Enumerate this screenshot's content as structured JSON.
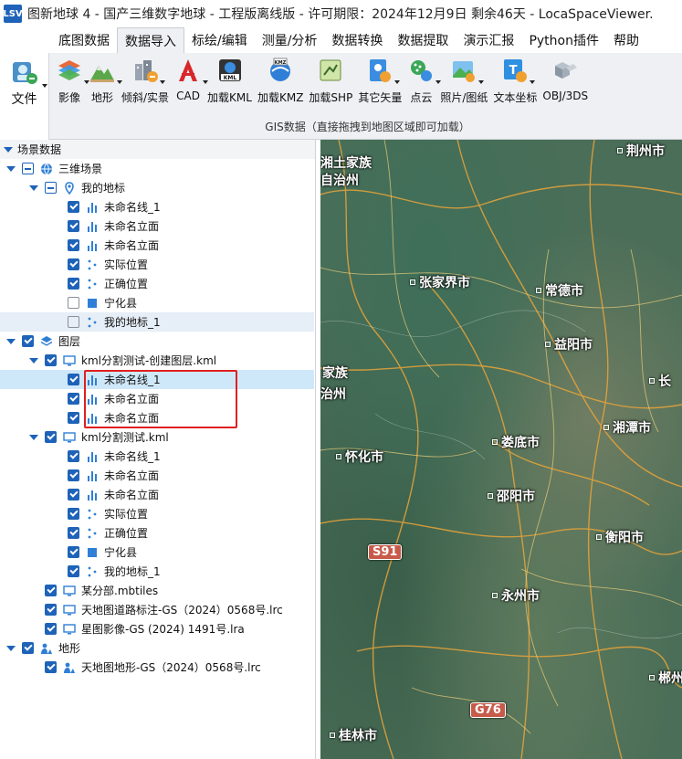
{
  "window": {
    "title": "图新地球 4 - 国产三维数字地球 - 工程版离线版 - 许可期限：2024年12月9日 剩余46天 - LocaSpaceViewer.",
    "logo_text": "LSV"
  },
  "menu": {
    "tabs": [
      {
        "label": "底图数据",
        "active": false
      },
      {
        "label": "数据导入",
        "active": true
      },
      {
        "label": "标绘/编辑",
        "active": false
      },
      {
        "label": "测量/分析",
        "active": false
      },
      {
        "label": "数据转换",
        "active": false
      },
      {
        "label": "数据提取",
        "active": false
      },
      {
        "label": "演示汇报",
        "active": false
      },
      {
        "label": "Python插件",
        "active": false
      },
      {
        "label": "帮助",
        "active": false
      }
    ]
  },
  "ribbon": {
    "file_label": "文件",
    "items": [
      {
        "label": "影像",
        "icon": "imagery-icon",
        "caret": true
      },
      {
        "label": "地形",
        "icon": "terrain-icon",
        "caret": true
      },
      {
        "label": "倾斜/实景",
        "icon": "oblique-icon",
        "caret": true
      },
      {
        "label": "CAD",
        "icon": "cad-icon",
        "caret": true
      },
      {
        "label": "加载KML",
        "icon": "kml-icon",
        "caret": false
      },
      {
        "label": "加载KMZ",
        "icon": "kmz-icon",
        "caret": false
      },
      {
        "label": "加载SHP",
        "icon": "shp-icon",
        "caret": false
      },
      {
        "label": "其它矢量",
        "icon": "vector-icon",
        "caret": true
      },
      {
        "label": "点云",
        "icon": "pointcloud-icon",
        "caret": true
      },
      {
        "label": "照片/图纸",
        "icon": "photo-icon",
        "caret": true
      },
      {
        "label": "文本坐标",
        "icon": "text-coord-icon",
        "caret": true
      },
      {
        "label": "OBJ/3DS",
        "icon": "obj-icon",
        "caret": false
      }
    ],
    "group_label": "GIS数据（直接拖拽到地图区域即可加载）"
  },
  "panel": {
    "header": "场景数据",
    "rows": [
      {
        "label": "三维场景",
        "depth": 0,
        "expand": true,
        "check": "partial",
        "icon": "globe-icon"
      },
      {
        "label": "我的地标",
        "depth": 1,
        "expand": true,
        "check": "partial",
        "icon": "pin-icon"
      },
      {
        "label": "未命名线_1",
        "depth": 2,
        "expand": false,
        "check": "checked",
        "icon": "chart-icon"
      },
      {
        "label": "未命名立面",
        "depth": 2,
        "expand": false,
        "check": "checked",
        "icon": "chart-icon"
      },
      {
        "label": "未命名立面",
        "depth": 2,
        "expand": false,
        "check": "checked",
        "icon": "chart-icon"
      },
      {
        "label": "实际位置",
        "depth": 2,
        "expand": false,
        "check": "checked",
        "icon": "points-icon"
      },
      {
        "label": "正确位置",
        "depth": 2,
        "expand": false,
        "check": "checked",
        "icon": "points-icon"
      },
      {
        "label": "宁化县",
        "depth": 2,
        "expand": false,
        "check": "empty",
        "icon": "square-icon"
      },
      {
        "label": "我的地标_1",
        "depth": 2,
        "expand": false,
        "check": "empty",
        "icon": "points-icon",
        "state": "alt"
      },
      {
        "label": "图层",
        "depth": 0,
        "expand": true,
        "check": "checked",
        "icon": "layers-icon"
      },
      {
        "label": "kml分割测试-创建图层.kml",
        "depth": 1,
        "expand": true,
        "check": "checked",
        "icon": "monitor-icon"
      },
      {
        "label": "未命名线_1",
        "depth": 2,
        "expand": false,
        "check": "checked",
        "icon": "chart-icon",
        "state": "sel"
      },
      {
        "label": "未命名立面",
        "depth": 2,
        "expand": false,
        "check": "checked",
        "icon": "chart-icon"
      },
      {
        "label": "未命名立面",
        "depth": 2,
        "expand": false,
        "check": "checked",
        "icon": "chart-icon"
      },
      {
        "label": "kml分割测试.kml",
        "depth": 1,
        "expand": true,
        "check": "checked",
        "icon": "monitor-icon"
      },
      {
        "label": "未命名线_1",
        "depth": 2,
        "expand": false,
        "check": "checked",
        "icon": "chart-icon"
      },
      {
        "label": "未命名立面",
        "depth": 2,
        "expand": false,
        "check": "checked",
        "icon": "chart-icon"
      },
      {
        "label": "未命名立面",
        "depth": 2,
        "expand": false,
        "check": "checked",
        "icon": "chart-icon"
      },
      {
        "label": "实际位置",
        "depth": 2,
        "expand": false,
        "check": "checked",
        "icon": "points-icon"
      },
      {
        "label": "正确位置",
        "depth": 2,
        "expand": false,
        "check": "checked",
        "icon": "points-icon"
      },
      {
        "label": "宁化县",
        "depth": 2,
        "expand": false,
        "check": "checked",
        "icon": "square-icon"
      },
      {
        "label": "我的地标_1",
        "depth": 2,
        "expand": false,
        "check": "checked",
        "icon": "points-icon"
      },
      {
        "label": "某分部.mbtiles",
        "depth": 1,
        "expand": false,
        "check": "checked",
        "icon": "monitor-icon"
      },
      {
        "label": "天地图道路标注-GS（2024）0568号.lrc",
        "depth": 1,
        "expand": false,
        "check": "checked",
        "icon": "monitor-icon"
      },
      {
        "label": "星图影像-GS (2024) 1491号.lra",
        "depth": 1,
        "expand": false,
        "check": "checked",
        "icon": "monitor-icon"
      },
      {
        "label": "地形",
        "depth": 0,
        "expand": true,
        "check": "checked",
        "icon": "terrain-small-icon"
      },
      {
        "label": "天地图地形-GS（2024）0568号.lrc",
        "depth": 1,
        "expand": false,
        "check": "checked",
        "icon": "terrain-small-icon"
      }
    ]
  },
  "map": {
    "cities": [
      {
        "label": "荆州市",
        "dot": true
      },
      {
        "label": "张家界市",
        "dot": true
      },
      {
        "label": "常德市",
        "dot": true
      },
      {
        "label": "益阳市",
        "dot": true
      },
      {
        "label": "湘潭市",
        "dot": true
      },
      {
        "label": "娄底市",
        "dot": true
      },
      {
        "label": "怀化市",
        "dot": true
      },
      {
        "label": "邵阳市",
        "dot": true
      },
      {
        "label": "衡阳市",
        "dot": true
      },
      {
        "label": "永州市",
        "dot": true
      },
      {
        "label": "郴州",
        "dot": true
      },
      {
        "label": "桂林市",
        "dot": true
      },
      {
        "label": "长",
        "dot": true
      }
    ],
    "regions": [
      "湘土家族",
      "自治州",
      "家族",
      "治州"
    ],
    "shields": [
      "S91",
      "G76"
    ]
  },
  "colors": {
    "accent": "#1e63b8",
    "selection": "#cfe8f9",
    "highlight_box": "#e02020"
  }
}
